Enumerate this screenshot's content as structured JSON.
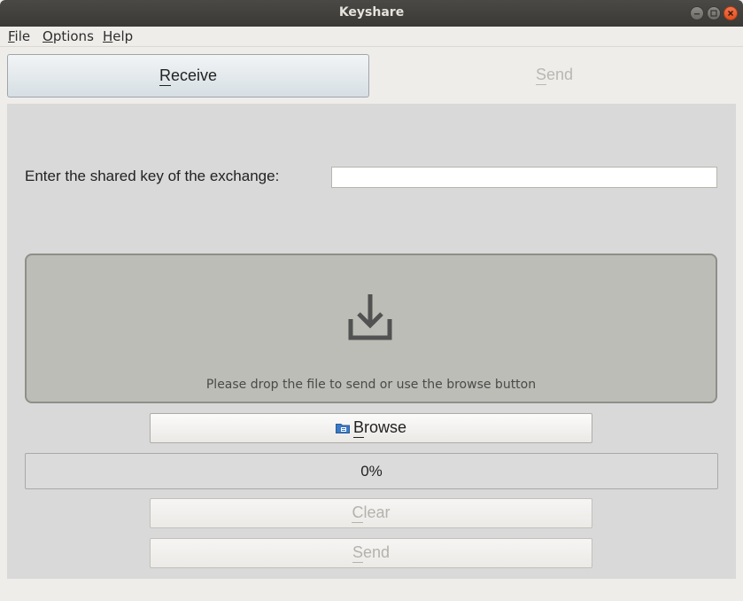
{
  "window": {
    "title": "Keyshare"
  },
  "menu": {
    "file": {
      "mnemonic": "F",
      "rest": "ile"
    },
    "options": {
      "mnemonic": "O",
      "rest": "ptions"
    },
    "help": {
      "mnemonic": "H",
      "rest": "elp"
    }
  },
  "tabs": {
    "receive": {
      "mnemonic": "R",
      "rest": "eceive",
      "active": true
    },
    "send": {
      "mnemonic": "S",
      "rest": "end",
      "active": false
    }
  },
  "form": {
    "key_label": "Enter the shared key of the exchange:",
    "key_value": ""
  },
  "dropzone": {
    "icon": "download-icon",
    "text": "Please drop the file to send or use the browse button"
  },
  "buttons": {
    "browse": {
      "icon": "folder-icon",
      "mnemonic": "B",
      "rest": "rowse",
      "enabled": true
    },
    "clear": {
      "mnemonic": "C",
      "rest": "lear",
      "enabled": false
    },
    "send": {
      "mnemonic": "S",
      "rest": "end",
      "enabled": false
    }
  },
  "progress": {
    "value": 0,
    "text": "0%"
  },
  "colors": {
    "panel": "#d9d9d9",
    "dropzone": "#bbbdb6",
    "disabled_text": "#b4b2ad"
  }
}
